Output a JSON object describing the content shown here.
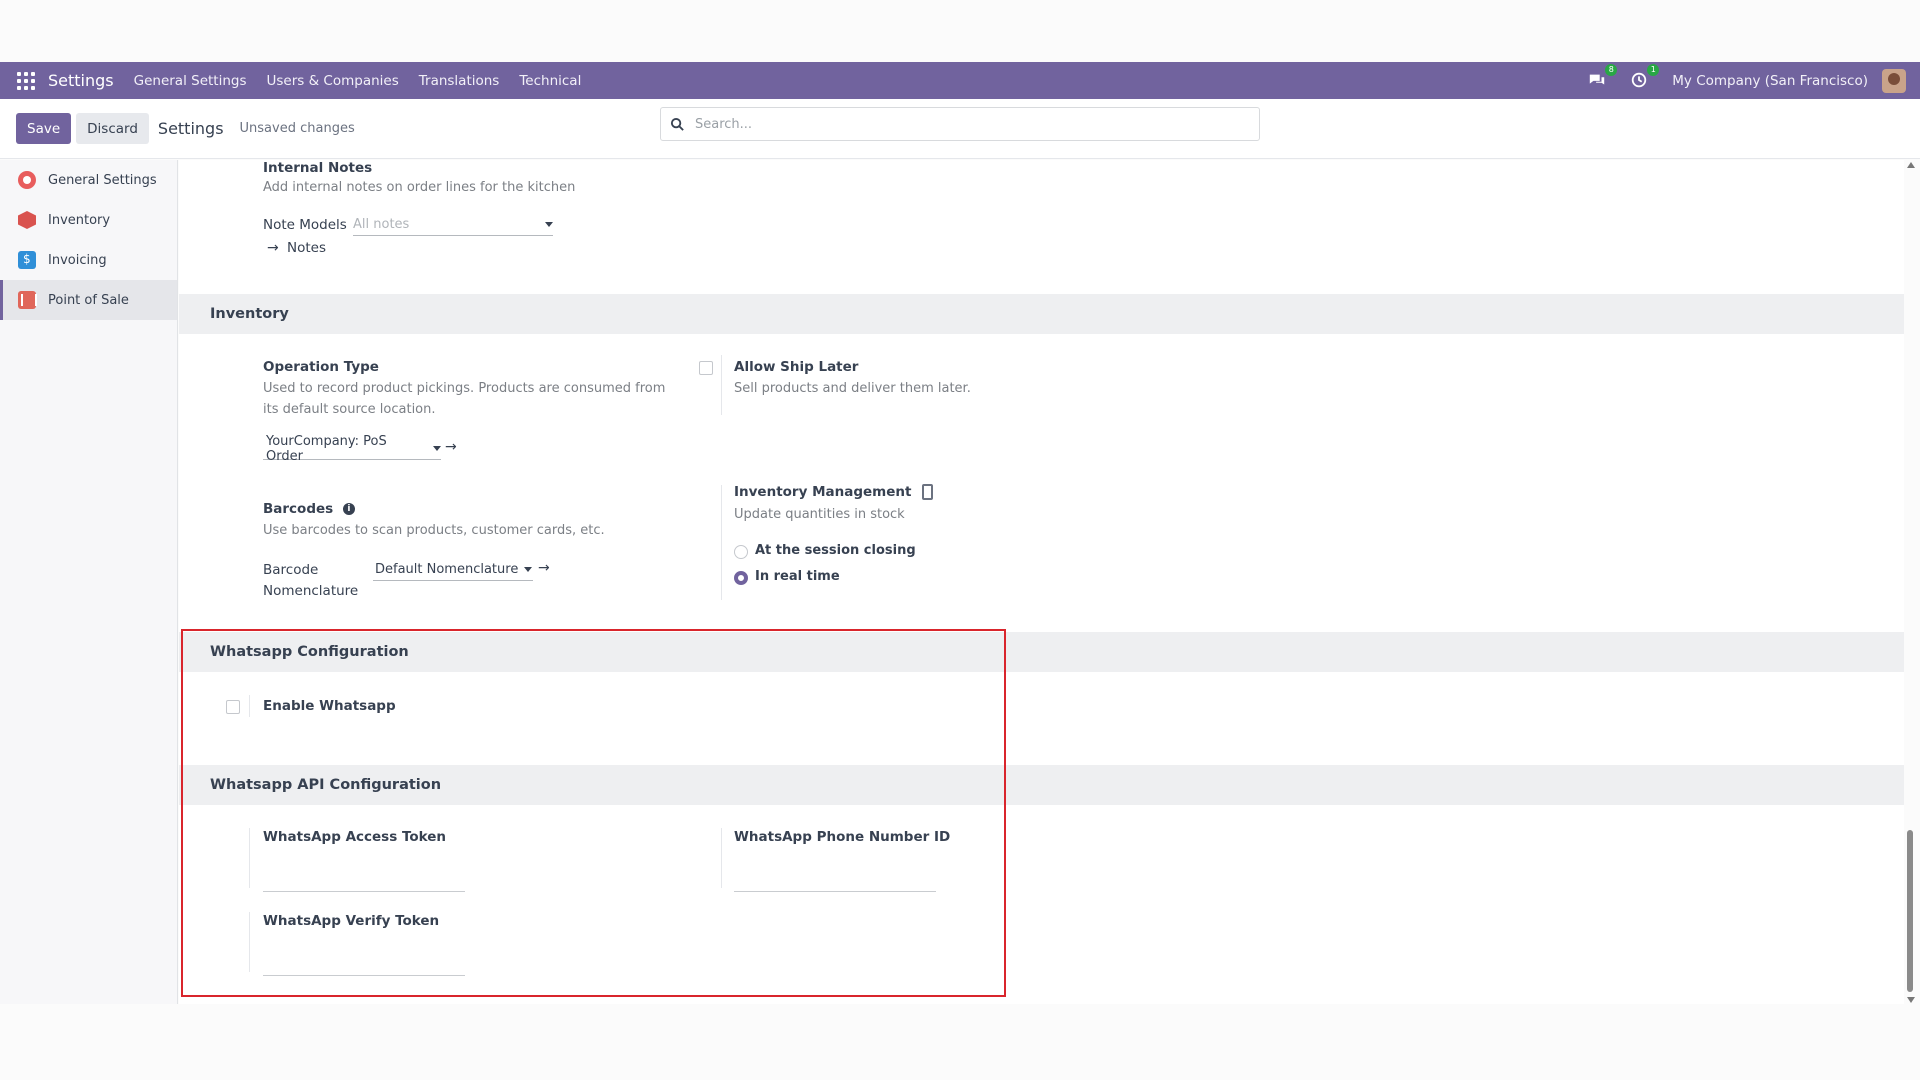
{
  "navbar": {
    "brand": "Settings",
    "menu": [
      "General Settings",
      "Users & Companies",
      "Translations",
      "Technical"
    ],
    "messages_badge": "8",
    "activities_badge": "1",
    "company": "My Company (San Francisco)"
  },
  "control_panel": {
    "save_label": "Save",
    "discard_label": "Discard",
    "title": "Settings",
    "status": "Unsaved changes",
    "search_placeholder": "Search..."
  },
  "sidebar": {
    "items": [
      {
        "label": "General Settings",
        "icon": "general-settings-icon"
      },
      {
        "label": "Inventory",
        "icon": "inventory-icon"
      },
      {
        "label": "Invoicing",
        "icon": "invoicing-icon"
      },
      {
        "label": "Point of Sale",
        "icon": "pos-icon",
        "active": true
      }
    ]
  },
  "internal_notes": {
    "title": "Internal Notes",
    "desc": "Add internal notes on order lines for the kitchen",
    "note_models_label": "Note Models",
    "note_models_placeholder": "All notes",
    "link": "Notes"
  },
  "inventory": {
    "header": "Inventory",
    "operation_type": {
      "title": "Operation Type",
      "desc_line1": "Used to record product pickings. Products are consumed from",
      "desc_line2": "its default source location.",
      "value": "YourCompany: PoS Order"
    },
    "allow_ship_later": {
      "title": "Allow Ship Later",
      "desc": "Sell products and deliver them later.",
      "checked": false
    },
    "barcodes": {
      "title": "Barcodes",
      "desc": "Use barcodes to scan products, customer cards, etc.",
      "nomenclature_label_line1": "Barcode",
      "nomenclature_label_line2": "Nomenclature",
      "nomenclature_value": "Default Nomenclature"
    },
    "inventory_management": {
      "title": "Inventory Management",
      "desc": "Update quantities in stock",
      "options": [
        "At the session closing",
        "In real time"
      ],
      "selected": "In real time"
    }
  },
  "whatsapp": {
    "header": "Whatsapp Configuration",
    "enable_label": "Enable Whatsapp",
    "enabled": false
  },
  "whatsapp_api": {
    "header": "Whatsapp API Configuration",
    "access_token_label": "WhatsApp Access Token",
    "phone_number_id_label": "WhatsApp Phone Number ID",
    "verify_token_label": "WhatsApp Verify Token",
    "access_token_value": "",
    "phone_number_id_value": "",
    "verify_token_value": ""
  },
  "colors": {
    "brand": "#71639e",
    "highlight": "#d9252c",
    "badge": "#28a745"
  }
}
